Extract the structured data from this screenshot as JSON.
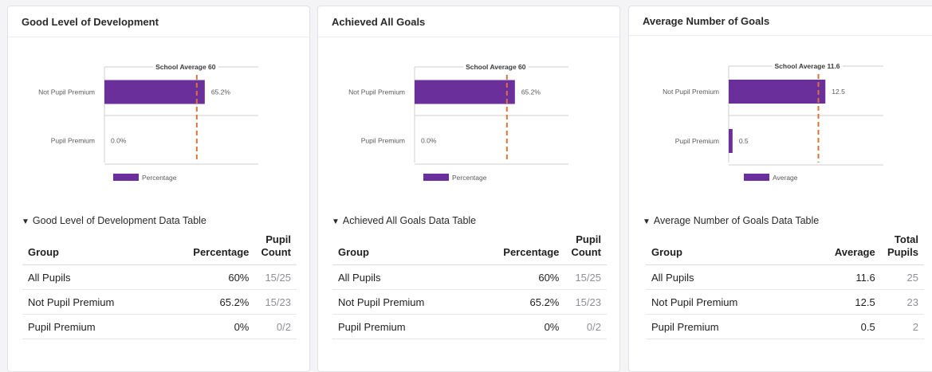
{
  "colors": {
    "bar": "#6a2f9b",
    "average_line": "#d9753a",
    "axis": "#cfcfd4"
  },
  "panels": [
    {
      "title": "Good Level of Development",
      "table_toggle": "Good Level of Development Data Table",
      "chart_data": {
        "type": "bar",
        "orientation": "horizontal",
        "categories": [
          "Not Pupil Premium",
          "Pupil Premium"
        ],
        "series": [
          {
            "name": "Percentage",
            "values": [
              65.2,
              0.0
            ]
          }
        ],
        "value_labels": [
          "65.2%",
          "0.0%"
        ],
        "xlim": [
          0,
          100
        ],
        "reference_line": {
          "label": "School Average 60",
          "value": 60
        },
        "legend": "bottom"
      },
      "table": {
        "headers": [
          "Group",
          "Percentage",
          "Pupil Count"
        ],
        "rows": [
          [
            "All Pupils",
            "60%",
            "15/25"
          ],
          [
            "Not Pupil Premium",
            "65.2%",
            "15/23"
          ],
          [
            "Pupil Premium",
            "0%",
            "0/2"
          ]
        ]
      }
    },
    {
      "title": "Achieved All Goals",
      "table_toggle": "Achieved All Goals Data Table",
      "chart_data": {
        "type": "bar",
        "orientation": "horizontal",
        "categories": [
          "Not Pupil Premium",
          "Pupil Premium"
        ],
        "series": [
          {
            "name": "Percentage",
            "values": [
              65.2,
              0.0
            ]
          }
        ],
        "value_labels": [
          "65.2%",
          "0.0%"
        ],
        "xlim": [
          0,
          100
        ],
        "reference_line": {
          "label": "School Average 60",
          "value": 60
        },
        "legend": "bottom"
      },
      "table": {
        "headers": [
          "Group",
          "Percentage",
          "Pupil Count"
        ],
        "rows": [
          [
            "All Pupils",
            "60%",
            "15/25"
          ],
          [
            "Not Pupil Premium",
            "65.2%",
            "15/23"
          ],
          [
            "Pupil Premium",
            "0%",
            "0/2"
          ]
        ]
      }
    },
    {
      "title": "Average Number of Goals",
      "table_toggle": "Average Number of Goals Data Table",
      "chart_data": {
        "type": "bar",
        "orientation": "horizontal",
        "categories": [
          "Not Pupil Premium",
          "Pupil Premium"
        ],
        "series": [
          {
            "name": "Average",
            "values": [
              12.5,
              0.5
            ]
          }
        ],
        "value_labels": [
          "12.5",
          "0.5"
        ],
        "xlim": [
          0,
          20
        ],
        "reference_line": {
          "label": "School Average 11.6",
          "value": 11.6
        },
        "legend": "bottom"
      },
      "table": {
        "headers": [
          "Group",
          "Average",
          "Total Pupils"
        ],
        "rows": [
          [
            "All Pupils",
            "11.6",
            "25"
          ],
          [
            "Not Pupil Premium",
            "12.5",
            "23"
          ],
          [
            "Pupil Premium",
            "0.5",
            "2"
          ]
        ]
      }
    }
  ]
}
